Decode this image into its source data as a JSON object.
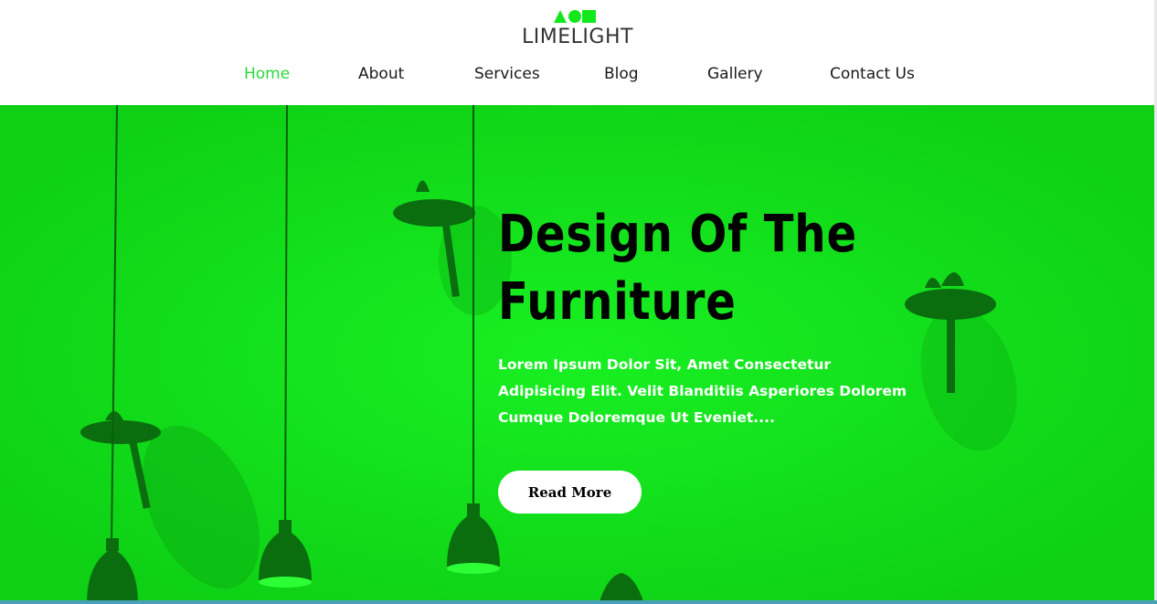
{
  "brand": {
    "name": "LIMELIGHT",
    "accent": "#12e81b"
  },
  "nav": {
    "items": [
      {
        "label": "Home",
        "active": true
      },
      {
        "label": "About"
      },
      {
        "label": "Services"
      },
      {
        "label": "Blog"
      },
      {
        "label": "Gallery"
      },
      {
        "label": "Contact Us"
      }
    ]
  },
  "hero": {
    "title_line1": "Design Of The",
    "title_line2": "Furniture",
    "text": "Lorem Ipsum Dolor Sit, Amet Consectetur Adipisicing Elit. Velit Blanditiis Asperiores Dolorem Cumque Doloremque Ut Eveniet....",
    "button_label": "Read More"
  }
}
